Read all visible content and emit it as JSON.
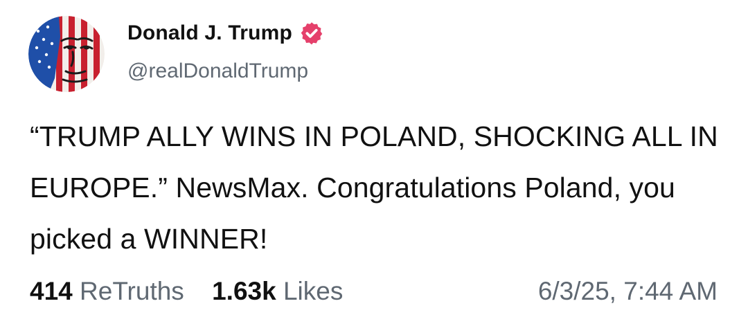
{
  "author": {
    "display_name": "Donald J. Trump",
    "handle": "@realDonaldTrump",
    "verified_icon": "verified-badge-icon",
    "verified_color": "#e5406b"
  },
  "post": {
    "text": "“TRUMP ALLY WINS IN POLAND, SHOCKING ALL IN EUROPE.” NewsMax. Congratulations Poland, you picked a WINNER!"
  },
  "stats": {
    "retruths_count": "414",
    "retruths_label": "ReTruths",
    "likes_count": "1.63k",
    "likes_label": "Likes"
  },
  "timestamp": "6/3/25, 7:44 AM"
}
